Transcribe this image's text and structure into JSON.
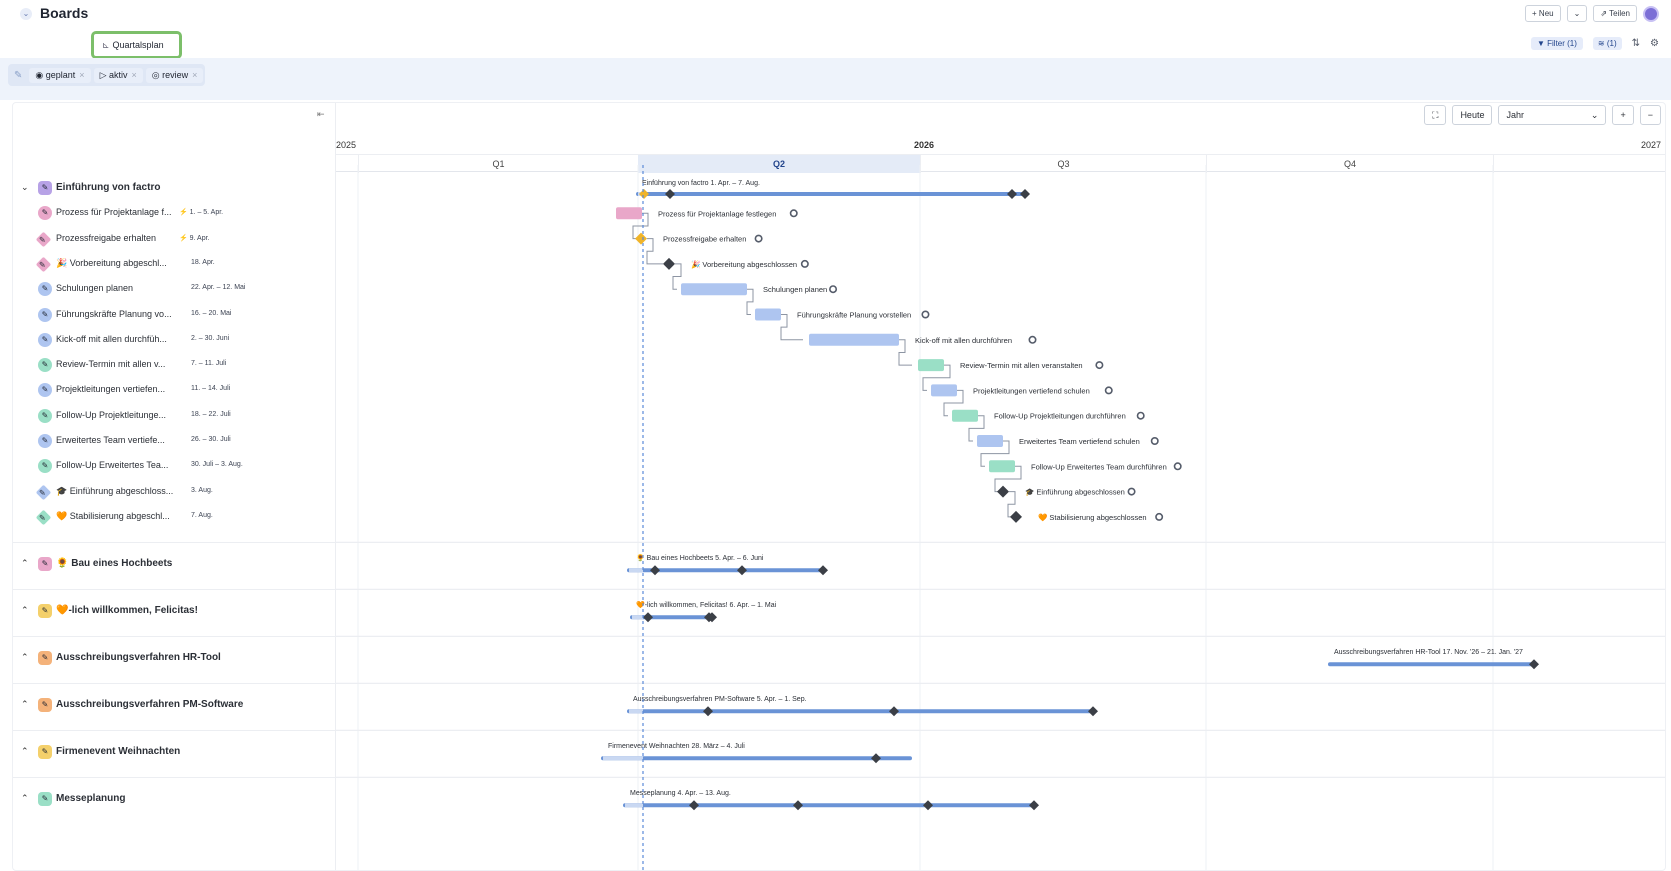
{
  "header": {
    "title": "Boards",
    "new_label": "+ Neu",
    "share_label": "Teilen"
  },
  "view": {
    "active_tab": "Quartalsplan",
    "filter_label": "Filter (1)",
    "layer_label": "(1)"
  },
  "filters": [
    {
      "label": "geplant"
    },
    {
      "label": "aktiv"
    },
    {
      "label": "review"
    }
  ],
  "timeline": {
    "today_label": "Heute",
    "zoom_value": "Jahr",
    "year_labels": [
      "2025",
      "2026",
      "2027"
    ],
    "quarters": [
      "Q1",
      "Q2",
      "Q3",
      "Q4"
    ]
  },
  "groups": [
    {
      "title": "Einführung von factro",
      "dates": "1. Apr. – 7. Aug.",
      "expanded": true,
      "color": "#b7a2e6",
      "tasks": [
        {
          "label": "Prozess für Projektanlage f...",
          "full": "Prozess für Projektanlage festlegen",
          "dates": "1. – 5. Apr.",
          "type": "task",
          "color": "#e9a7c9",
          "prefix": "⚡"
        },
        {
          "label": "Prozessfreigabe erhalten",
          "full": "Prozessfreigabe erhalten",
          "dates": "9. Apr.",
          "type": "milestone",
          "color": "#e9a7c9",
          "prefix": "⚡"
        },
        {
          "label": "🎉 Vorbereitung abgeschl...",
          "full": "🎉 Vorbereitung abgeschlossen",
          "dates": "18. Apr.",
          "type": "milestone",
          "color": "#e9a7c9",
          "prefix": ""
        },
        {
          "label": "Schulungen planen",
          "full": "Schulungen planen",
          "dates": "22. Apr. – 12. Mai",
          "type": "task",
          "color": "#aec5f0",
          "prefix": ""
        },
        {
          "label": "Führungskräfte Planung vo...",
          "full": "Führungskräfte Planung vorstellen",
          "dates": "16. – 20. Mai",
          "type": "task",
          "color": "#aec5f0",
          "prefix": ""
        },
        {
          "label": "Kick-off mit allen durchfüh...",
          "full": "Kick-off mit allen durchführen",
          "dates": "2. – 30. Juni",
          "type": "task",
          "color": "#aec5f0",
          "prefix": ""
        },
        {
          "label": "Review-Termin mit allen v...",
          "full": "Review-Termin mit allen veranstalten",
          "dates": "7. – 11. Juli",
          "type": "task",
          "color": "#9adfc6",
          "prefix": ""
        },
        {
          "label": "Projektleitungen vertiefen...",
          "full": "Projektleitungen vertiefend schulen",
          "dates": "11. – 14. Juli",
          "type": "task",
          "color": "#aec5f0",
          "prefix": ""
        },
        {
          "label": "Follow-Up Projektleitunge...",
          "full": "Follow-Up Projektleitungen durchführen",
          "dates": "18. – 22. Juli",
          "type": "task",
          "color": "#9adfc6",
          "prefix": ""
        },
        {
          "label": "Erweitertes Team vertiefe...",
          "full": "Erweitertes Team vertiefend schulen",
          "dates": "26. – 30. Juli",
          "type": "task",
          "color": "#aec5f0",
          "prefix": ""
        },
        {
          "label": "Follow-Up Erweitertes Tea...",
          "full": "Follow-Up Erweitertes Team durchführen",
          "dates": "30. Juli – 3. Aug.",
          "type": "task",
          "color": "#9adfc6",
          "prefix": ""
        },
        {
          "label": "🎓 Einführung abgeschloss...",
          "full": "🎓 Einführung abgeschlossen",
          "dates": "3. Aug.",
          "type": "milestone",
          "color": "#aec5f0",
          "prefix": ""
        },
        {
          "label": "🧡 Stabilisierung abgeschl...",
          "full": "🧡 Stabilisierung abgeschlossen",
          "dates": "7. Aug.",
          "type": "milestone",
          "color": "#9adfc6",
          "prefix": ""
        }
      ]
    },
    {
      "title": "🌻 Bau eines Hochbeets",
      "bar_label": "🌻 Bau eines Hochbeets",
      "dates": "5. Apr. – 6. Juni",
      "expanded": false,
      "color": "#e9a7c9"
    },
    {
      "title": "🧡-lich willkommen, Felicitas!",
      "bar_label": "🧡-lich willkommen, Felicitas!",
      "dates": "6. Apr. – 1. Mai",
      "expanded": false,
      "color": "#f4d06b"
    },
    {
      "title": "Ausschreibungsverfahren HR-Tool",
      "bar_label": "Ausschreibungsverfahren HR-Tool",
      "dates": "17. Nov. '26 – 21. Jan. '27",
      "expanded": false,
      "color": "#f4b27a"
    },
    {
      "title": "Ausschreibungsverfahren PM-Software",
      "bar_label": "Ausschreibungsverfahren PM-Software",
      "dates": "5. Apr. – 1. Sep.",
      "expanded": false,
      "color": "#f4b27a"
    },
    {
      "title": "Firmenevent Weihnachten",
      "bar_label": "Firmenevent Weihnachten",
      "dates": "28. März – 4. Juli",
      "expanded": false,
      "color": "#f4d06b"
    },
    {
      "title": "Messeplanung",
      "bar_label": "Messeplanung",
      "dates": "4. Apr. – 13. Aug.",
      "expanded": false,
      "color": "#9adfc6"
    }
  ],
  "colors": {
    "accent": "#2f5fb8",
    "bar": "#6a93d6",
    "milestone_dark": "#3b3f46",
    "milestone_gold": "#f0b429",
    "today_line": "#5b8ad8",
    "view_tab_border": "#7cbf6a"
  }
}
